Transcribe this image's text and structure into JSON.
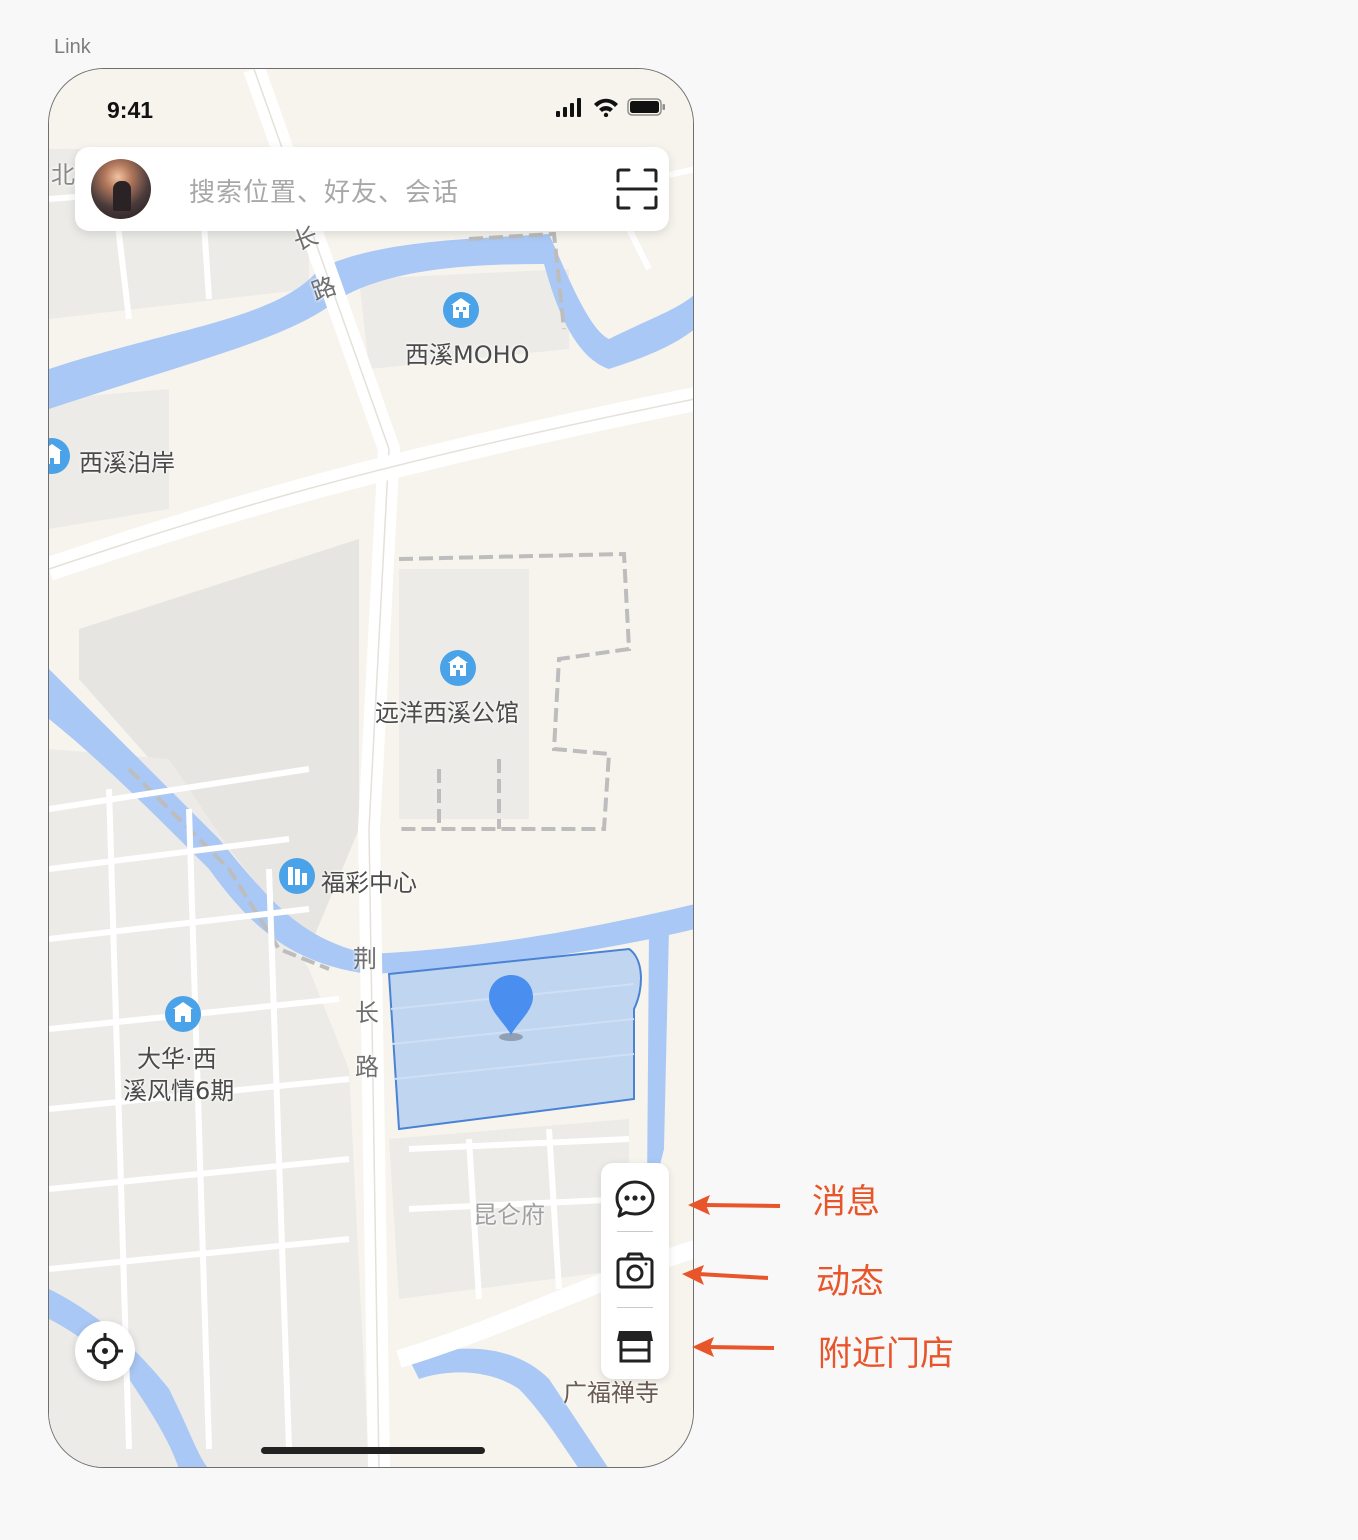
{
  "frame": {
    "label": "Link"
  },
  "status_bar": {
    "time": "9:41"
  },
  "search": {
    "placeholder": "搜索位置、好友、会话"
  },
  "map": {
    "pois": [
      {
        "name": "西溪MOHO"
      },
      {
        "name": "西溪泊岸"
      },
      {
        "name": "远洋西溪公馆"
      },
      {
        "name": "福彩中心"
      },
      {
        "name_line1": "大华·西",
        "name_line2": "溪风情6期"
      },
      {
        "name": "昆仑府"
      },
      {
        "name": "广福禅寺"
      }
    ],
    "roads": {
      "north_char_1": "长",
      "north_char_2": "路",
      "south_char_1": "荆",
      "south_char_2": "长",
      "south_char_3": "路",
      "edge_north": "北"
    },
    "colors": {
      "water": "#aac8f5",
      "land": "#f7f4ee",
      "block": "#ecebe8",
      "highlight": "#b6cff0",
      "pin": "#4a8ef0",
      "poi_icon": "#4aa3e8"
    }
  },
  "side_panel": {
    "buttons": [
      {
        "icon": "message-icon"
      },
      {
        "icon": "camera-icon"
      },
      {
        "icon": "store-icon"
      }
    ]
  },
  "annotations": {
    "message": "消息",
    "moments": "动态",
    "nearby_stores": "附近门店",
    "color": "#e8552a"
  }
}
